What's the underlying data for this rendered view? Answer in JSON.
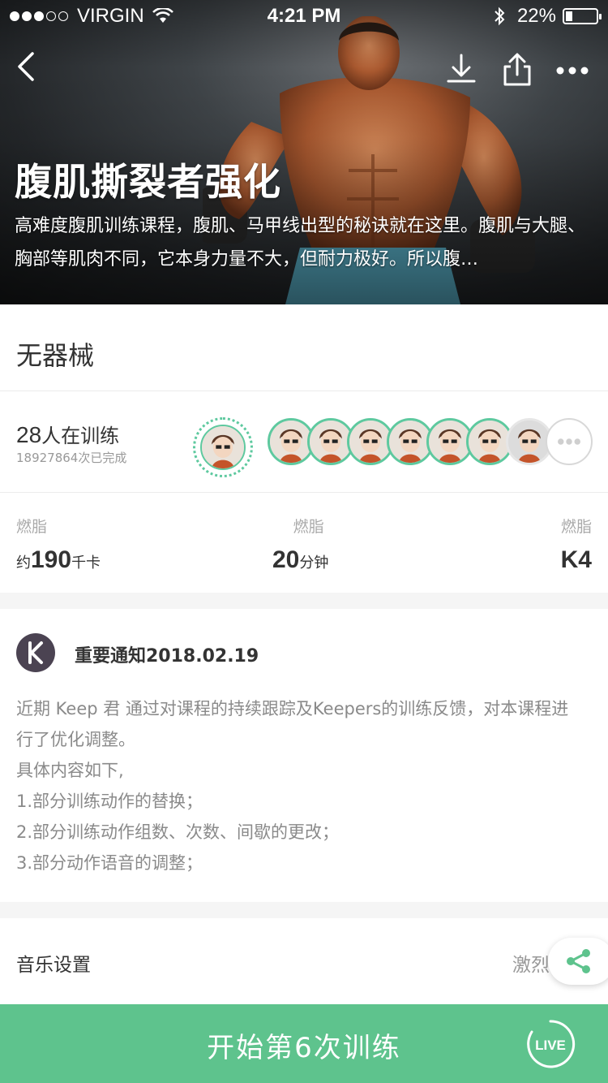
{
  "status_bar": {
    "carrier": "VIRGIN",
    "time": "4:21 PM",
    "battery": "22%",
    "battery_level": 0.22
  },
  "hero": {
    "title": "腹肌撕裂者强化",
    "description": "高难度腹肌训练课程，腹肌、马甲线出型的秘诀就在这里。腹肌与大腿、胸部等肌肉不同，它本身力量不大，但耐力极好。所以腹…"
  },
  "equipment": {
    "label": "无器械"
  },
  "trainers": {
    "count": "28",
    "count_suffix": "人在训练",
    "completed": "18927864次已完成"
  },
  "stats": [
    {
      "label": "燃脂",
      "prefix": "约",
      "value": "190",
      "unit": "千卡"
    },
    {
      "label": "燃脂",
      "prefix": "",
      "value": "20",
      "unit": "分钟"
    },
    {
      "label": "燃脂",
      "prefix": "",
      "value": "K4",
      "unit": ""
    }
  ],
  "notice": {
    "title": "重要通知2018.02.19",
    "lines": [
      "近期 Keep 君 通过对课程的持续跟踪及Keepers的训练反馈，对本课程进行了优化调整。",
      "具体内容如下,",
      "1.部分训练动作的替换；",
      "2.部分训练动作组数、次数、间歇的更改；",
      "3.部分动作语音的调整；"
    ]
  },
  "music": {
    "label": "音乐设置",
    "value": "激烈"
  },
  "start": {
    "label": "开始第6次训练",
    "live_label": "LIVE"
  },
  "colors": {
    "accent": "#5ec38d",
    "avatar_ring": "#5ec99f",
    "keep_logo": "#4b4352"
  },
  "icons": [
    "back-icon",
    "download-icon",
    "share-icon",
    "more-icon",
    "keep-logo-icon",
    "share-fab-icon",
    "live-icon"
  ]
}
